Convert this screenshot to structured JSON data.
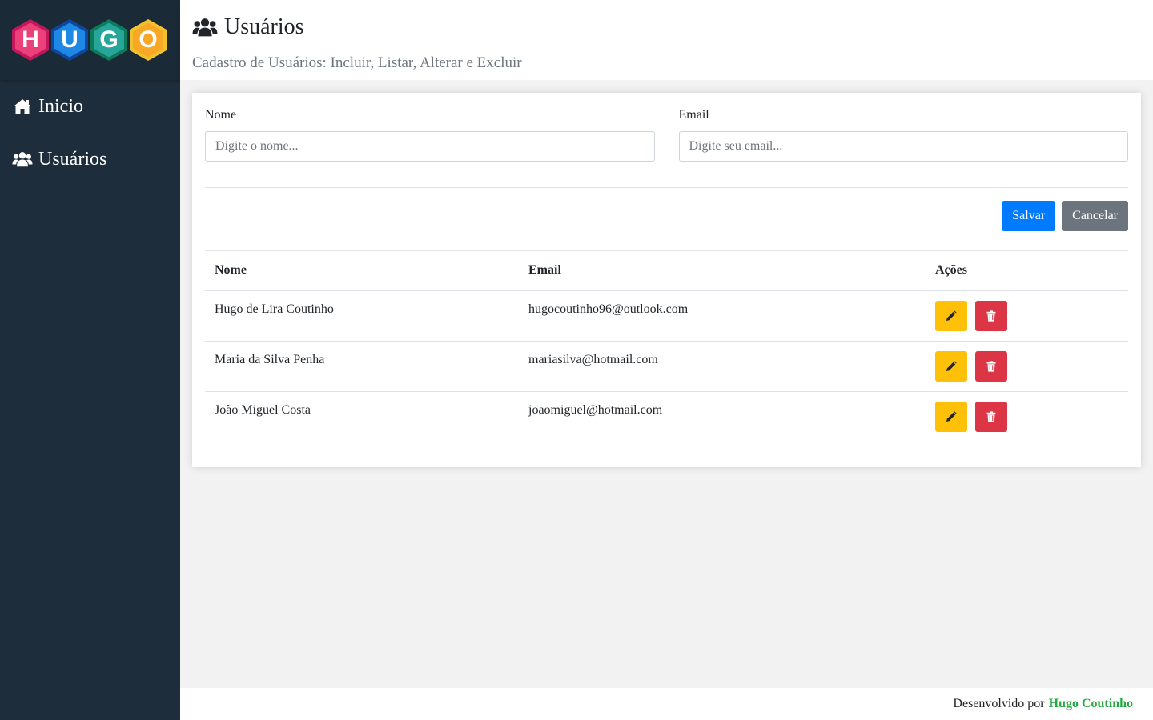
{
  "logo": {
    "letters": [
      {
        "char": "H",
        "outer": "#c2185b",
        "inner": "#ec407a"
      },
      {
        "char": "U",
        "outer": "#0d47a1",
        "inner": "#1e88e5"
      },
      {
        "char": "G",
        "outer": "#0d7a5a",
        "inner": "#26a69a"
      },
      {
        "char": "O",
        "outer": "#f2c12e",
        "inner": "#f9a825"
      }
    ]
  },
  "sidebar": {
    "items": [
      {
        "label": "Inicio",
        "icon": "home-icon"
      },
      {
        "label": "Usuários",
        "icon": "users-icon"
      }
    ]
  },
  "header": {
    "title": "Usuários",
    "subtitle": "Cadastro de Usuários: Incluir, Listar, Alterar e Excluir"
  },
  "form": {
    "name_label": "Nome",
    "name_placeholder": "Digite o nome...",
    "email_label": "Email",
    "email_placeholder": "Digite seu email...",
    "save_label": "Salvar",
    "cancel_label": "Cancelar"
  },
  "table": {
    "headers": [
      "Nome",
      "Email",
      "Ações"
    ],
    "rows": [
      {
        "name": "Hugo de Lira Coutinho",
        "email": "hugocoutinho96@outlook.com"
      },
      {
        "name": "Maria da Silva Penha",
        "email": "mariasilva@hotmail.com"
      },
      {
        "name": "João Miguel Costa",
        "email": "joaomiguel@hotmail.com"
      }
    ]
  },
  "footer": {
    "prefix": "Desenvolvido por",
    "author": "Hugo Coutinho"
  },
  "colors": {
    "sidebar": "#1e2d3b",
    "primary": "#007bff",
    "secondary": "#6c757d",
    "warning": "#ffc107",
    "danger": "#dc3545",
    "author": "#28a745"
  }
}
